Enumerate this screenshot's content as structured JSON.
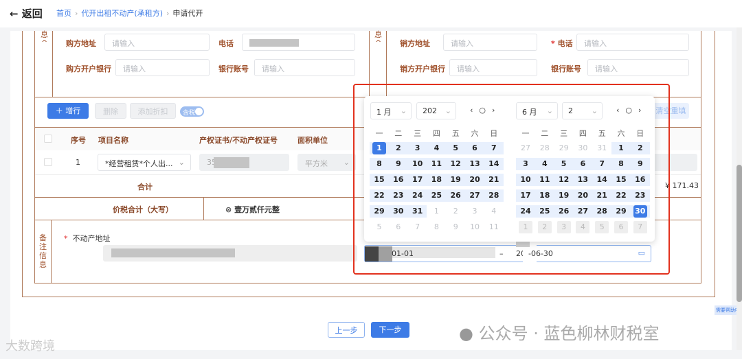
{
  "header": {
    "back": "返回",
    "breadcrumb": [
      "首页",
      "代开出租不动产(承租方)",
      "申请代开"
    ]
  },
  "buyer": {
    "section_tail": "息",
    "collapse": "^",
    "address_label": "购方地址",
    "address_placeholder": "请输入",
    "phone_label": "电话",
    "bank_label": "购方开户银行",
    "bank_placeholder": "请输入",
    "account_label": "银行账号",
    "account_placeholder": "请输入"
  },
  "seller": {
    "section_tail": "息",
    "collapse": "^",
    "address_label": "销方地址",
    "address_placeholder": "请输入",
    "phone_label": "电话",
    "phone_placeholder": "请输入",
    "bank_label": "销方开户银行",
    "bank_placeholder": "请输入",
    "account_label": "银行账号",
    "account_placeholder": "请输入",
    "clear_btn": "清空重填"
  },
  "toolbar": {
    "add_row": "增行",
    "delete": "删除",
    "add_discount": "添加折扣",
    "tax_toggle": "含税"
  },
  "table": {
    "headers": [
      "序号",
      "项目名称",
      "产权证书/不动产权证号",
      "面积单位"
    ],
    "row": {
      "index": "1",
      "item": "*经营租赁*个人出...",
      "cert": "35",
      "unit": "平方米"
    },
    "total_label": "合计",
    "total_value": "¥ 171.43",
    "tax_total_label": "价税合计（大写）",
    "tax_total_value": "壹万贰仟元整"
  },
  "remarks": {
    "section": "备注信息",
    "address_label": "不动产地址"
  },
  "calendar": {
    "left": {
      "month": "1 月",
      "year": "202",
      "weekdays": [
        "一",
        "二",
        "三",
        "四",
        "五",
        "六",
        "日"
      ],
      "days": [
        [
          "1",
          2,
          3,
          4,
          5,
          6,
          7
        ],
        [
          8,
          9,
          10,
          11,
          12,
          13,
          14
        ],
        [
          15,
          16,
          17,
          18,
          19,
          20,
          21
        ],
        [
          22,
          23,
          24,
          25,
          26,
          27,
          28
        ],
        [
          29,
          30,
          31,
          1,
          2,
          3,
          4
        ],
        [
          5,
          6,
          7,
          8,
          9,
          10,
          11
        ]
      ]
    },
    "right": {
      "month": "6 月",
      "year": "2",
      "weekdays": [
        "一",
        "二",
        "三",
        "四",
        "五",
        "六",
        "日"
      ],
      "days": [
        [
          27,
          28,
          29,
          30,
          31,
          1,
          2
        ],
        [
          3,
          4,
          5,
          6,
          7,
          8,
          9
        ],
        [
          10,
          11,
          12,
          13,
          14,
          15,
          16
        ],
        [
          17,
          18,
          19,
          20,
          21,
          22,
          23
        ],
        [
          24,
          25,
          26,
          27,
          28,
          29,
          30
        ],
        [
          1,
          2,
          3,
          4,
          5,
          6,
          7
        ]
      ]
    },
    "start": "01-01",
    "sep": "–",
    "end_prefix": "20",
    "end": "-06-30"
  },
  "footer": {
    "prev": "上一步",
    "next": "下一步",
    "help": "需要帮助吗",
    "watermark": "公众号 · 蓝色柳林财税室",
    "logo": "大数跨境"
  }
}
